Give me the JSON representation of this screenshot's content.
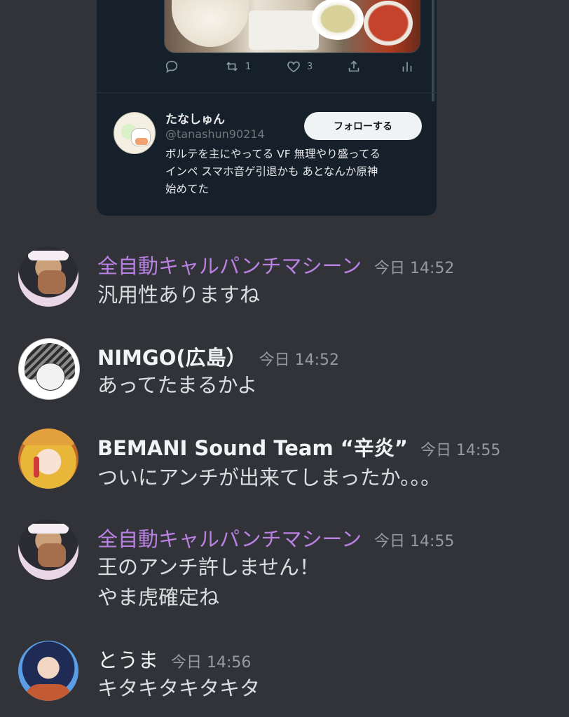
{
  "embed": {
    "actions": {
      "retweets": "1",
      "likes": "3"
    },
    "profile": {
      "name": "たなしゅん",
      "handle": "@tanashun90214",
      "follow_label": "フォローする",
      "bio_lines": [
        "ボルテを主にやってる VF 無理やり盛ってる",
        "インペ スマホ音ゲ引退かも あとなんか原神",
        "始めてた"
      ]
    }
  },
  "messages": [
    {
      "author": "全自動キャルパンチマシーン",
      "author_color": "#b981e2",
      "time": "今日 14:52",
      "lines": [
        "汎用性ありますね"
      ]
    },
    {
      "author": "NIMGO(広島）",
      "author_color": "#f2f3f5",
      "time": "今日 14:52",
      "lines": [
        "あってたまるかよ"
      ]
    },
    {
      "author": "BEMANI Sound Team “辛炎”",
      "author_color": "#f2f3f5",
      "time": "今日 14:55",
      "lines": [
        "ついにアンチが出来てしまったか。。。"
      ]
    },
    {
      "author": "全自動キャルパンチマシーン",
      "author_color": "#b981e2",
      "time": "今日 14:55",
      "lines": [
        "王のアンチ許しません！",
        "やま虎確定ね"
      ]
    },
    {
      "author": "とうま",
      "author_color": "#f2f3f5",
      "time": "今日 14:56",
      "lines": [
        "キタキタキタキタ"
      ]
    }
  ]
}
